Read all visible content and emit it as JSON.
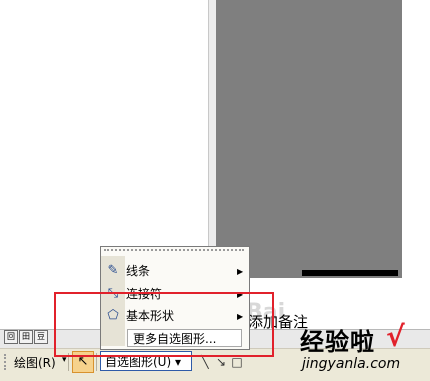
{
  "canvas": {
    "slide_placeholder": "添加备注"
  },
  "view_buttons": [
    "回",
    "田",
    "豆"
  ],
  "toolbar": {
    "draw_label": "绘图(R)",
    "draw_arrow": "▾",
    "pointer_glyph": "↖",
    "autoshapes_label": "自选图形(U) ▾",
    "line_glyph": "╲",
    "arrow_glyph": "↘",
    "rect_glyph": "□"
  },
  "autoshapes_menu": {
    "items": [
      {
        "label": "线条",
        "icon": "lines-icon",
        "glyph": "✎",
        "submenu": true
      },
      {
        "label": "连接符",
        "icon": "connector-icon",
        "glyph": "⤡",
        "submenu": true
      },
      {
        "label": "基本形状",
        "icon": "basic-shapes-icon",
        "glyph": "⬠",
        "submenu": true
      }
    ],
    "more_label": "更多自选图形...",
    "submenu_glyph": "▶"
  },
  "watermark": {
    "text": "经验啦",
    "check": "√",
    "url": "jingyanla.com",
    "baidu": "Bai"
  },
  "colors": {
    "highlight": "#e1212b",
    "menu_bg": "#fbfaf6",
    "toolbar_bg": "#ece9d8",
    "gray_panel": "#7f7f7f"
  }
}
